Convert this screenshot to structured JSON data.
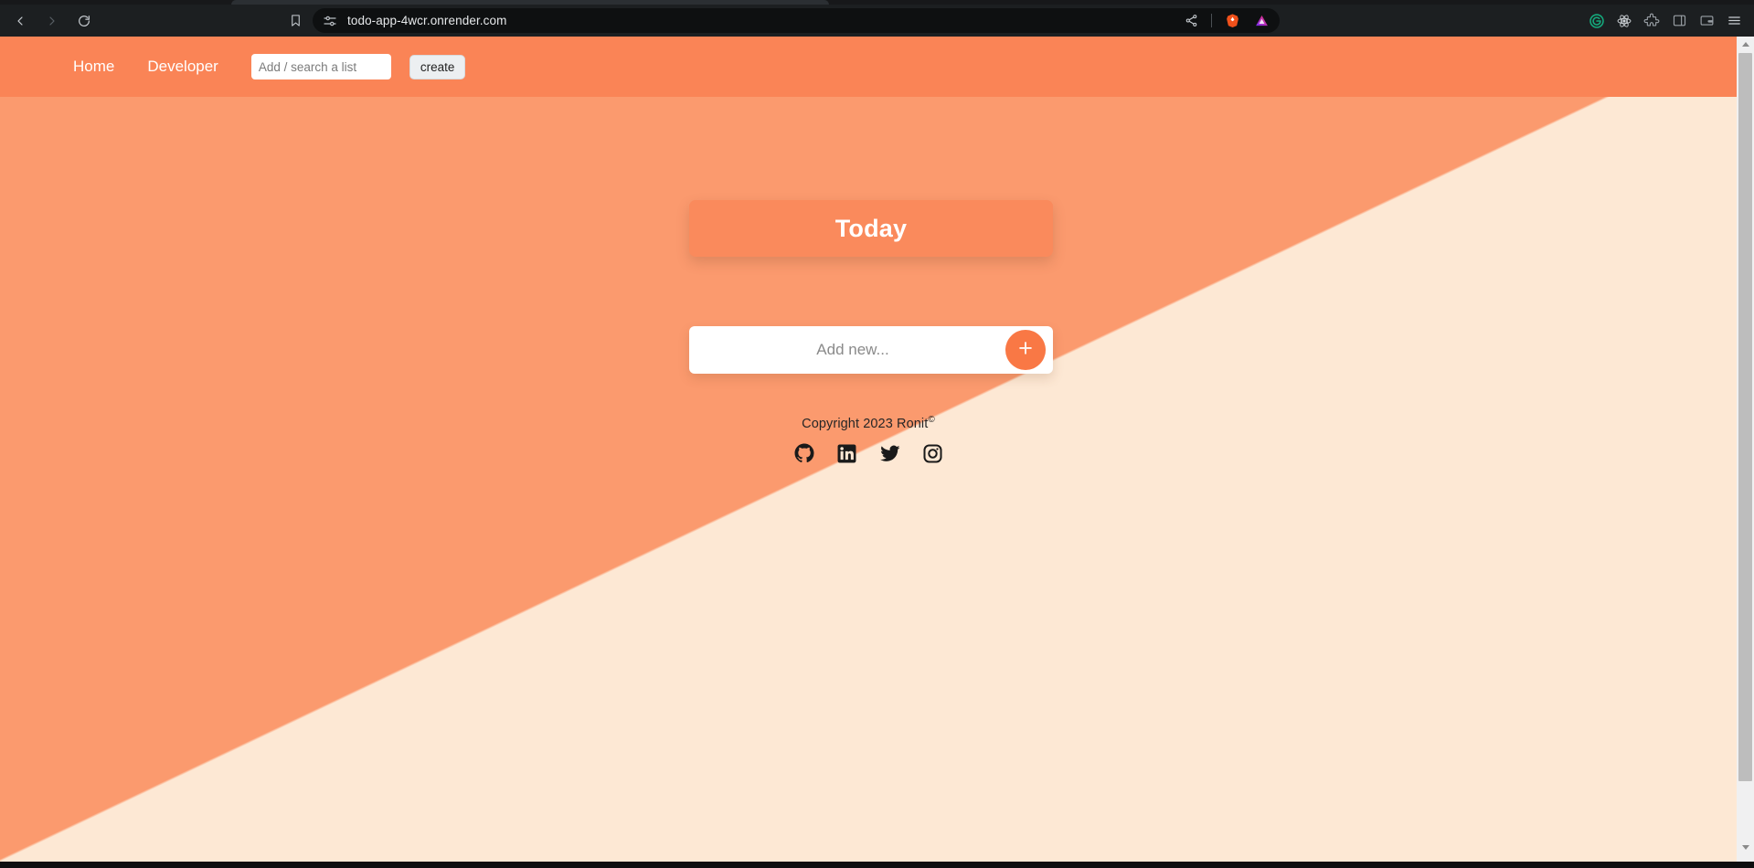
{
  "browser": {
    "back_icon": "chevron-left-icon",
    "forward_icon": "chevron-right-icon",
    "reload_icon": "reload-icon",
    "bookmark_icon": "bookmark-icon",
    "site_settings_icon": "site-settings-tune-icon",
    "url": "todo-app-4wcr.onrender.com",
    "share_icon": "share-icon",
    "brave_icon": "brave-lion-icon",
    "ai_icon": "leo-triangle-icon",
    "extensions": [
      {
        "name": "grammarly-extension-icon",
        "label": "G"
      },
      {
        "name": "react-devtools-extension-icon",
        "label": ""
      },
      {
        "name": "puzzle-extension-icon",
        "label": ""
      },
      {
        "name": "sidebar-toggle-icon",
        "label": ""
      },
      {
        "name": "wallet-icon",
        "label": ""
      },
      {
        "name": "browser-menu-icon",
        "label": ""
      }
    ]
  },
  "navbar": {
    "home_label": "Home",
    "developer_label": "Developer",
    "search_placeholder": "Add / search a list",
    "search_value": "",
    "create_label": "create"
  },
  "main": {
    "list_title": "Today",
    "add_placeholder": "Add new...",
    "add_value": "",
    "add_button_glyph": "+"
  },
  "footer": {
    "copyright_text": "Copyright 2023 Ronit",
    "copyright_symbol": "©",
    "socials": [
      {
        "name": "github-icon",
        "label": "GitHub"
      },
      {
        "name": "linkedin-icon",
        "label": "LinkedIn"
      },
      {
        "name": "twitter-icon",
        "label": "Twitter"
      },
      {
        "name": "instagram-icon",
        "label": "Instagram"
      }
    ]
  },
  "colors": {
    "navbar_orange": "#fa8456",
    "bg_orange": "#fb9a6e",
    "bg_cream": "#fde8d4",
    "card_orange": "#fa8a5c",
    "accent_orange": "#f97845",
    "chrome_dark": "#1c1f21"
  }
}
